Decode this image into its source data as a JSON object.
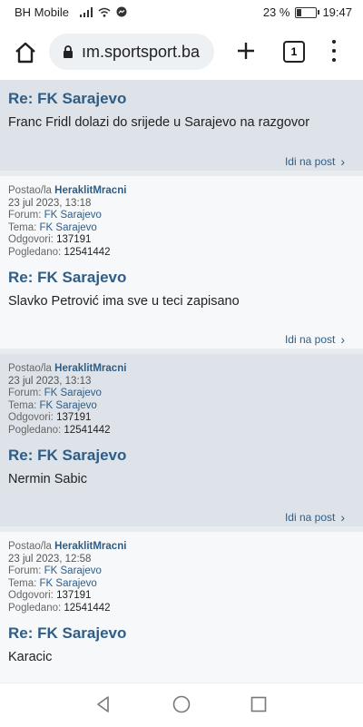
{
  "status": {
    "carrier": "BH Mobile",
    "battery": "23 %",
    "time": "19:47",
    "battery_level": 0.23
  },
  "browser": {
    "url": "ım.sportsport.ba",
    "tab_count": "1"
  },
  "goto_label": "Idi na post",
  "labels": {
    "posted_by": "Postao/la",
    "forum": "Forum:",
    "topic": "Tema:",
    "replies": "Odgovori:",
    "views": "Pogledano:"
  },
  "posts": [
    {
      "title": "Re: FK Sarajevo",
      "body": "Franc Fridl dolazi do srijede u Sarajevo na razgovor"
    },
    {
      "author": "HeraklitMracni",
      "date": "23 jul 2023, 13:18",
      "forum": "FK Sarajevo",
      "topic": "FK Sarajevo",
      "replies": "137191",
      "views": "12541442",
      "title": "Re: FK Sarajevo",
      "body": "Slavko Petrović ima sve u teci zapisano"
    },
    {
      "author": "HeraklitMracni",
      "date": "23 jul 2023, 13:13",
      "forum": "FK Sarajevo",
      "topic": "FK Sarajevo",
      "replies": "137191",
      "views": "12541442",
      "title": "Re: FK Sarajevo",
      "body": "Nermin Sabic"
    },
    {
      "author": "HeraklitMracni",
      "date": "23 jul 2023, 12:58",
      "forum": "FK Sarajevo",
      "topic": "FK Sarajevo",
      "replies": "137191",
      "views": "12541442",
      "title": "Re: FK Sarajevo",
      "body": "Karacic"
    }
  ]
}
